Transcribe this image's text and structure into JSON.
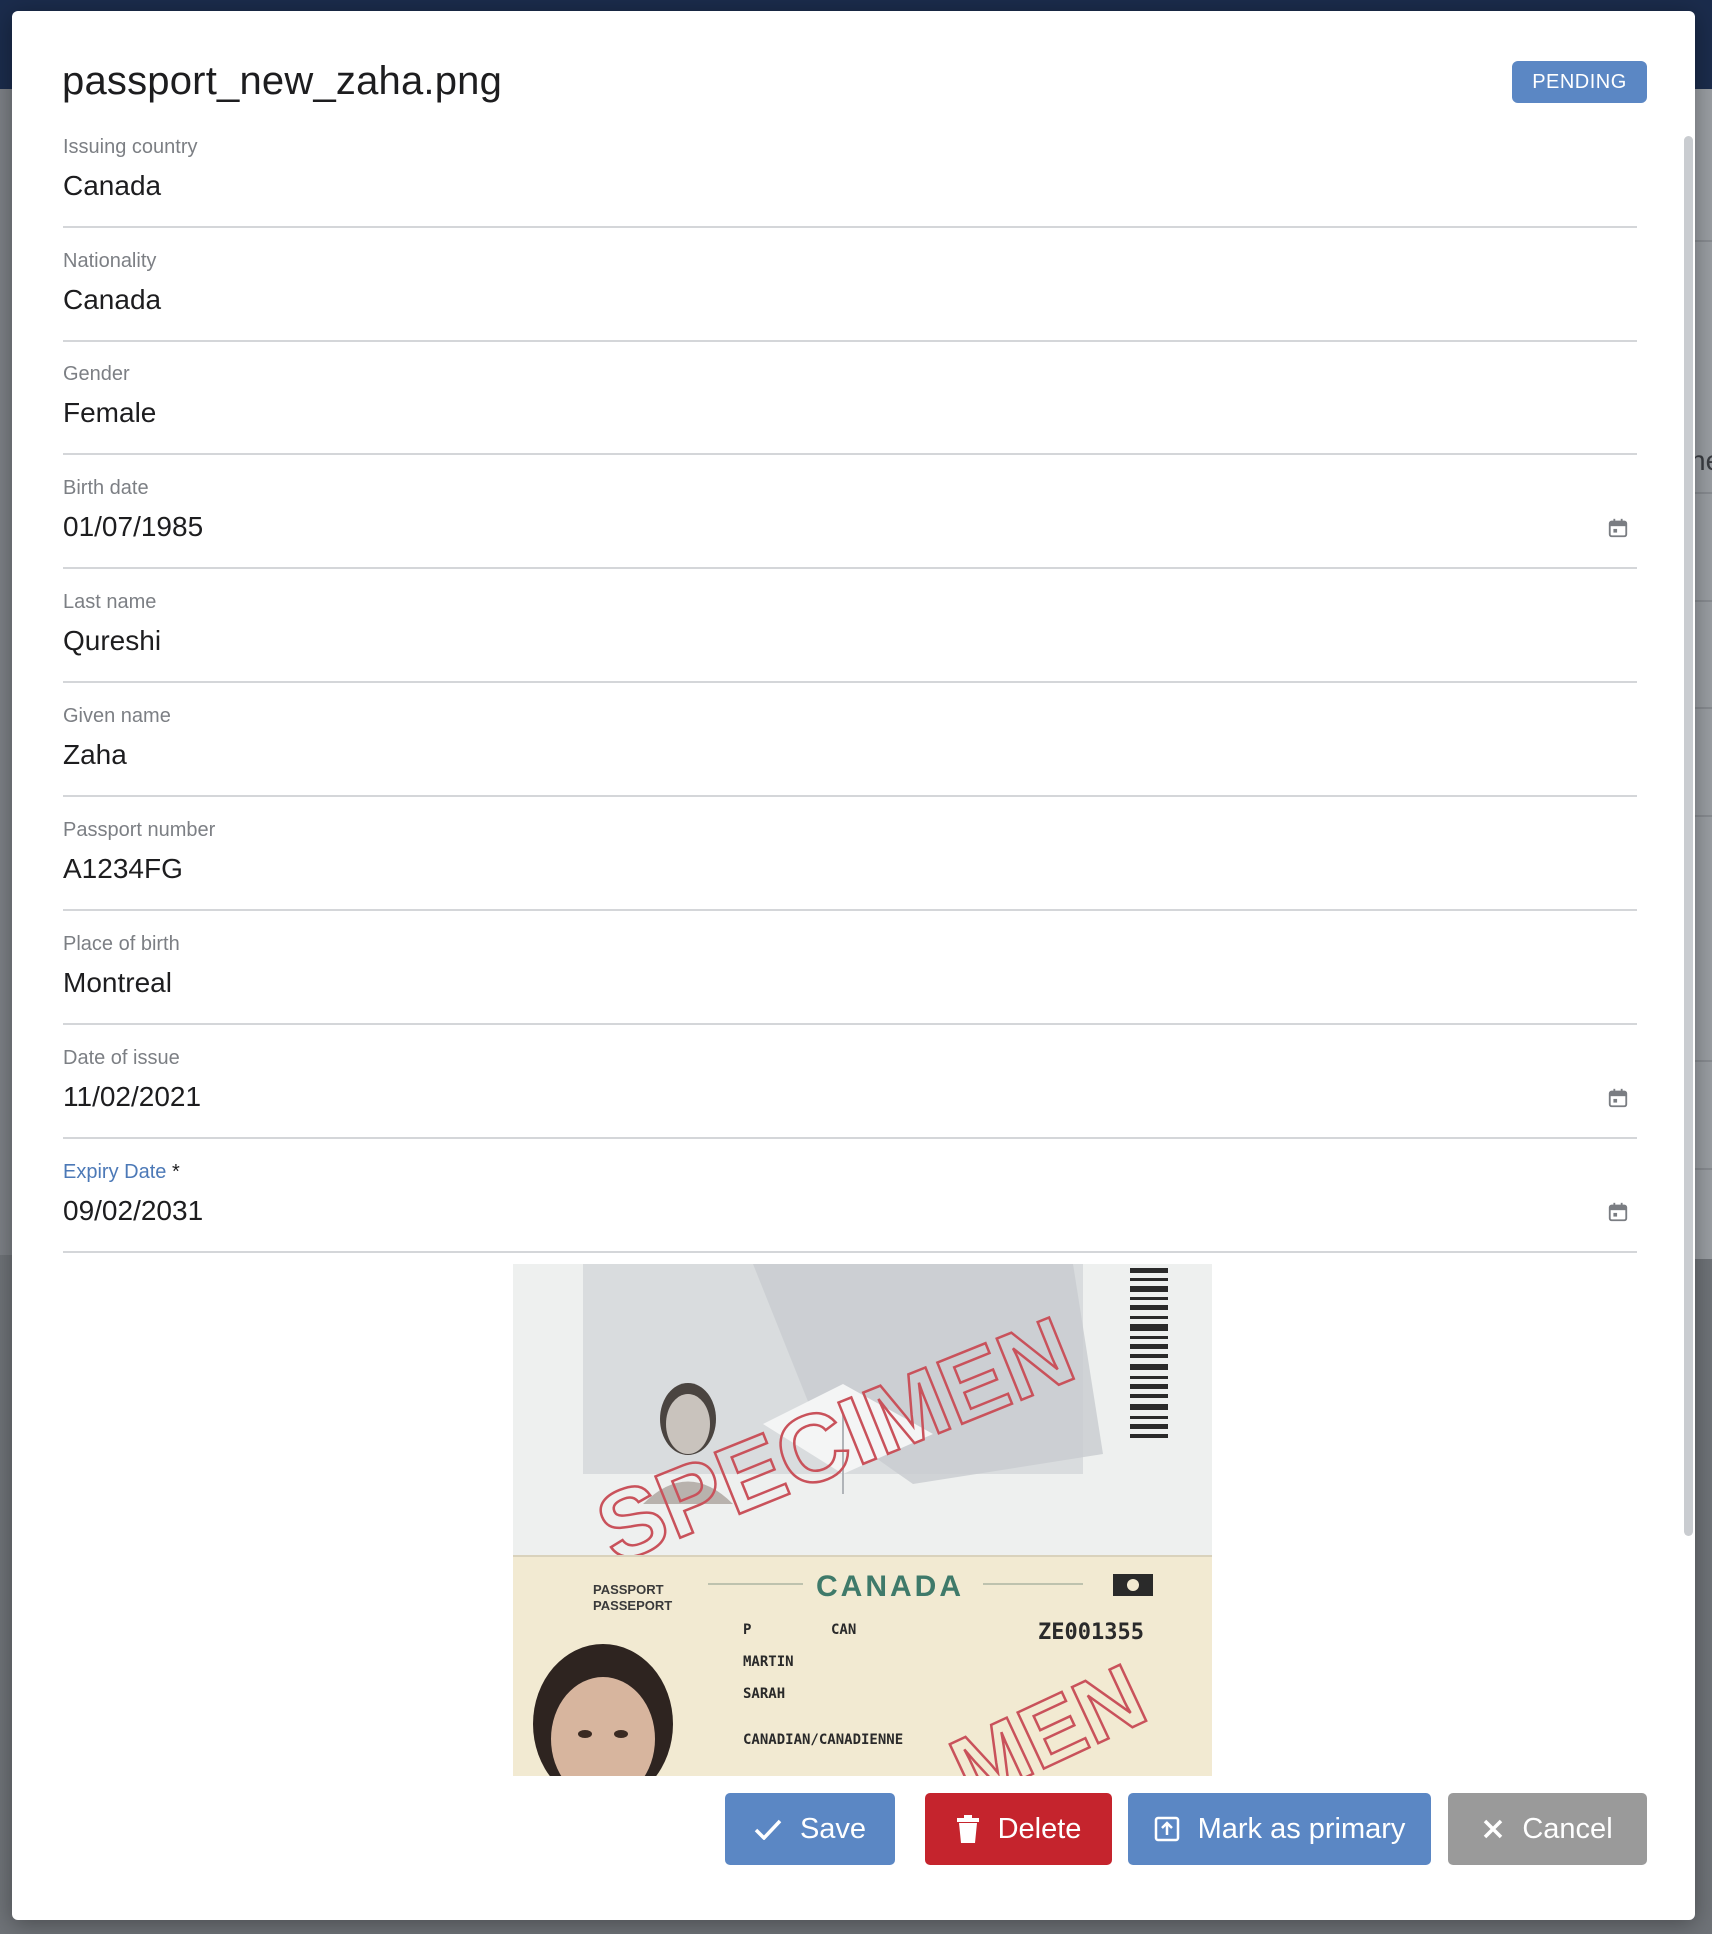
{
  "modal": {
    "title": "passport_new_zaha.png",
    "status": "PENDING"
  },
  "backdrop": {
    "partial_text": "ne"
  },
  "fields": {
    "issuing_country": {
      "label": "Issuing country",
      "value": "Canada"
    },
    "nationality": {
      "label": "Nationality",
      "value": "Canada"
    },
    "gender": {
      "label": "Gender",
      "value": "Female"
    },
    "birth_date": {
      "label": "Birth date",
      "value": "01/07/1985"
    },
    "last_name": {
      "label": "Last name",
      "value": "Qureshi"
    },
    "given_name": {
      "label": "Given name",
      "value": "Zaha"
    },
    "passport_number": {
      "label": "Passport number",
      "value": "A1234FG"
    },
    "place_of_birth": {
      "label": "Place of birth",
      "value": "Montreal"
    },
    "date_of_issue": {
      "label": "Date of issue",
      "value": "11/02/2021"
    },
    "expiry_date": {
      "label": "Expiry Date",
      "required_mark": "*",
      "value": "09/02/2031"
    }
  },
  "passport_image": {
    "watermark_top": "SPECIMEN",
    "country": "CANADA",
    "label_passport": "PASSPORT",
    "label_passeport": "PASSEPORT",
    "type": "P",
    "code": "CAN",
    "number": "ZE001355",
    "surname": "MARTIN",
    "given_names": "SARAH",
    "nationality": "CANADIAN/CANADIENNE",
    "watermark_bottom": "MEN"
  },
  "actions": {
    "save": "Save",
    "delete": "Delete",
    "mark_primary": "Mark as primary",
    "cancel": "Cancel"
  },
  "colors": {
    "primary": "#5b87c4",
    "danger": "#c5242d",
    "neutral": "#9a9a9a",
    "topbar": "#1b2c4c"
  }
}
